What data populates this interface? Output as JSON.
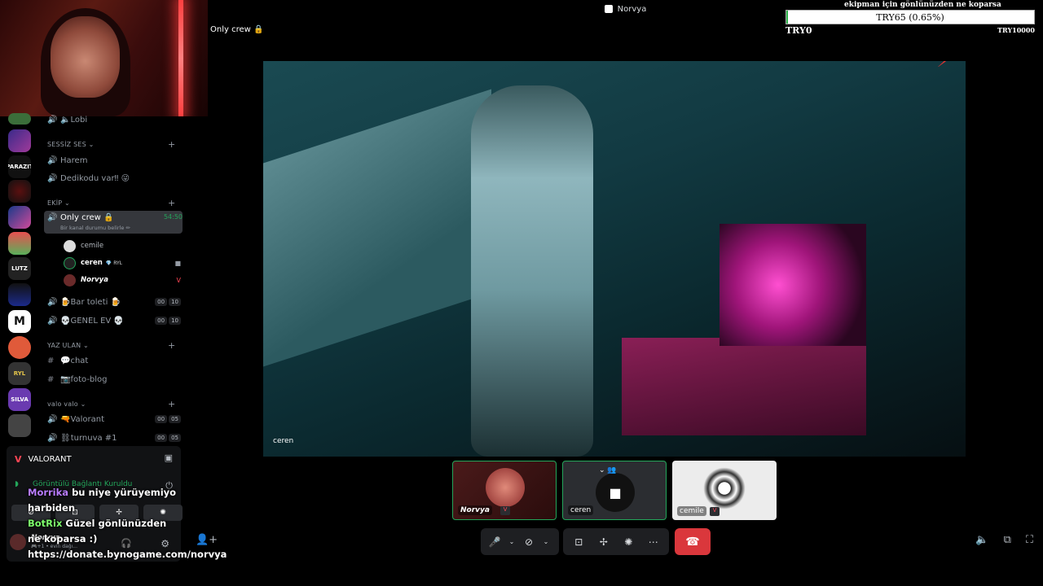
{
  "window": {
    "title": "Norvya",
    "controls": [
      "—",
      "☐",
      "✕"
    ]
  },
  "channel_header": {
    "title": "Only crew 🔒"
  },
  "server_rail": {
    "items": [
      {
        "name": "server-1",
        "label": ""
      },
      {
        "name": "server-parazit",
        "label": "PARAZIT"
      },
      {
        "name": "server-3",
        "label": ""
      },
      {
        "name": "server-4",
        "label": ""
      },
      {
        "name": "server-5",
        "label": ""
      },
      {
        "name": "server-lutz",
        "label": "LUTZ"
      },
      {
        "name": "server-7",
        "label": ""
      },
      {
        "name": "server-m",
        "label": "M"
      },
      {
        "name": "server-9",
        "label": ""
      },
      {
        "name": "server-ryl",
        "label": "RYL"
      },
      {
        "name": "server-silva",
        "label": "SILVA"
      },
      {
        "name": "server-12",
        "label": ""
      }
    ]
  },
  "channels": {
    "lobi": "🔈Lobi",
    "cat_sessiz": "SESSİZ SES ⌄",
    "harem": "Harem",
    "dedikodu": "Dedikodu var‼ 😜",
    "cat_ekip": "EKİP ⌄",
    "only_crew": {
      "label": "Only crew 🔒",
      "timer": "54:50",
      "sub": "Bir kanal durumu belirle ✏"
    },
    "members": [
      {
        "name": "cemile",
        "tag": "",
        "right": ""
      },
      {
        "name": "ceren",
        "tag": "💎 RYL",
        "right": "■"
      },
      {
        "name": "Norvya",
        "tag": "",
        "right": "V"
      }
    ],
    "bar": {
      "label": "🍺Bar toleti 🍺",
      "b1": "00",
      "b2": "10"
    },
    "genel": {
      "label": "💀GENEL EV 💀",
      "b1": "00",
      "b2": "10"
    },
    "cat_yaz": "YAZ ULAN ⌄",
    "chat": "💬chat",
    "foto": "📷foto-blog",
    "cat_valo": "valo valo ⌄",
    "valorant": {
      "label": "🔫Valorant",
      "b1": "00",
      "b2": "05"
    },
    "turnuva": {
      "label": "⛓turnuva #1",
      "b1": "00",
      "b2": "05"
    }
  },
  "voice_panel": {
    "title": "VALORANT",
    "status": "Görüntülü Bağlantı Kuruldu",
    "user": {
      "name": "Norvya",
      "status": "🎮+1 • evin dağı..."
    }
  },
  "chat_overlay": {
    "lines": [
      {
        "name": "Morrika",
        "text": "bu niye yürüyemiyo harbiden"
      },
      {
        "name": "BotRix",
        "text": "Güzel gönlünüzden ne koparsa :) https://donate.bynogame.com/norvya"
      }
    ]
  },
  "donation": {
    "title": "ekipman için gönlünüzden ne koparsa",
    "progress_text": "TRY65 (0.65%)",
    "progress_fraction": 0.0065,
    "min_label": "TRY0",
    "max_label": "TRY10000"
  },
  "main_video": {
    "label": "ceren"
  },
  "tiles": [
    {
      "name": "Norvya",
      "badge": "V"
    },
    {
      "name": "ceren",
      "badge": ""
    },
    {
      "name": "cemile",
      "badge": "V"
    }
  ],
  "colors": {
    "hangup": "#da373c",
    "accent_green": "#23a55a",
    "valorant_red": "#ff4655"
  }
}
